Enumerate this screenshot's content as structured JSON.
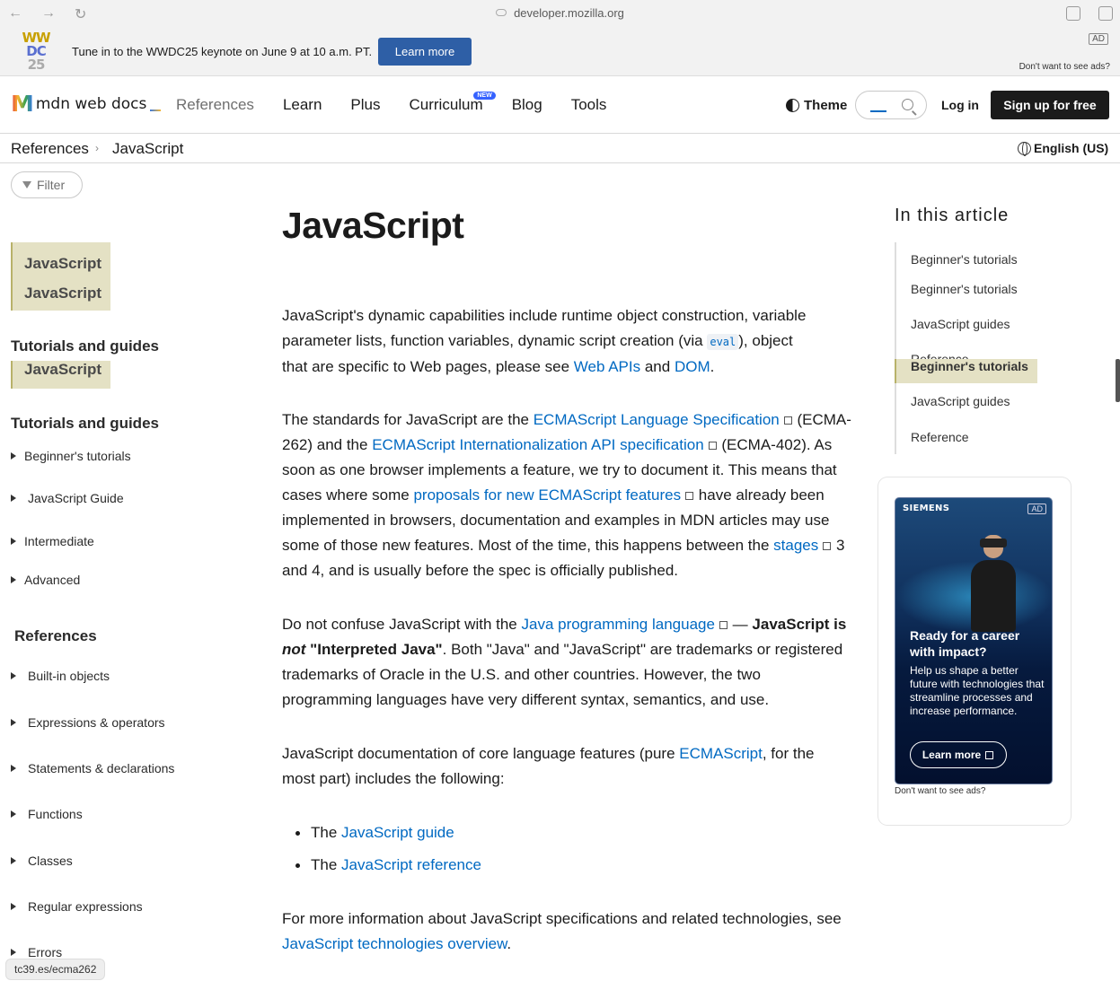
{
  "browser": {
    "url": "developer.mozilla.org",
    "back": "←",
    "forward": "→",
    "reload": "↻"
  },
  "ad_banner": {
    "logo_lines": [
      "WW",
      "DC",
      "25"
    ],
    "text": "Tune in to the WWDC25 keynote on June 9 at 10 a.m. PT.",
    "button": "Learn more",
    "ad_tag": "AD",
    "no_ads": "Don't want to see ads?"
  },
  "header": {
    "logo_text": "mdn web docs",
    "nav": [
      "References",
      "Learn",
      "Plus",
      "Curriculum",
      "Blog",
      "Tools"
    ],
    "new_badge": "NEW",
    "theme": "Theme",
    "login": "Log in",
    "signup": "Sign up for free"
  },
  "breadcrumb": {
    "items": [
      "References",
      "JavaScript"
    ],
    "separator": "›",
    "language": "English (US)"
  },
  "sidebar": {
    "filter": "Filter",
    "highlights": [
      "JavaScript",
      "JavaScript",
      "JavaScript"
    ],
    "tutorials_heading_1": "Tutorials and guides",
    "tutorials_heading_2": "Tutorials and guides",
    "tutorials": [
      "Beginner's tutorials",
      "JavaScript Guide",
      "Intermediate",
      "Advanced"
    ],
    "references_heading": "References",
    "references": [
      "Built-in objects",
      "Expressions & operators",
      "Statements & declarations",
      "Functions",
      "Classes",
      "Regular expressions",
      "Errors"
    ]
  },
  "status_url": "tc39.es/ecma262",
  "article": {
    "title": "JavaScript",
    "p1": {
      "a": "JavaScript's dynamic capabilities include runtime object construction, variable",
      "b": "parameter lists, function variables, dynamic script creation (via ",
      "code": "eval",
      "c": "), object",
      "d": "that are specific to Web pages, please see ",
      "link1": "Web APIs",
      "and": " and ",
      "link2": "DOM",
      "end": "."
    },
    "p2": {
      "a": "The standards for JavaScript are the ",
      "link1": "ECMAScript Language Specification",
      "b": " (ECMA-",
      "c": "262) and the ",
      "link2": "ECMAScript Internationalization API specification",
      "d": " (ECMA-402). As",
      "e": "soon as one browser implements a feature, we try to document it. This means that",
      "f": "cases where some ",
      "link3": "proposals for new ECMAScript features",
      "g": " have already been",
      "h": "implemented in browsers, documentation and examples in MDN articles may use",
      "i": "some of those new features. Most of the time, this happens between the ",
      "link4": "stages",
      "j": " 3",
      "k": "and 4, and is usually before the spec is officially published."
    },
    "p3": {
      "a": "Do not confuse JavaScript with the ",
      "link1": "Java programming language",
      "b": " — ",
      "bold1": "JavaScript is",
      "em": "not",
      "bold2": " \"Interpreted Java\"",
      "c": ". Both \"Java\" and \"JavaScript\" are trademarks or registered",
      "d": "trademarks of Oracle in the U.S. and other countries. However, the two",
      "e": "programming languages have very different syntax, semantics, and use."
    },
    "p4": {
      "a": "JavaScript documentation of core language features (pure ",
      "link1": "ECMAScript",
      "b": ", for the",
      "c": "most part) includes the following:"
    },
    "bullets": [
      {
        "prefix": "The ",
        "link": "JavaScript guide"
      },
      {
        "prefix": "The ",
        "link": "JavaScript reference"
      }
    ],
    "p5": {
      "a": "For more information about JavaScript specifications and related technologies, see",
      "link1": "JavaScript technologies overview",
      "end": "."
    }
  },
  "toc": {
    "title": "In this article",
    "items": [
      "Beginner's tutorials",
      "Beginner's tutorials",
      "JavaScript guides",
      "Reference",
      "JavaScript guides",
      "Reference"
    ],
    "active": "Beginner's tutorials"
  },
  "side_ad": {
    "brand": "SIEMENS",
    "tag": "AD",
    "headline": "Ready for a career with impact?",
    "body": "Help us shape a better future with technologies that streamline processes and increase performance.",
    "button": "Learn more",
    "no_ads": "Don't want to see ads?"
  }
}
